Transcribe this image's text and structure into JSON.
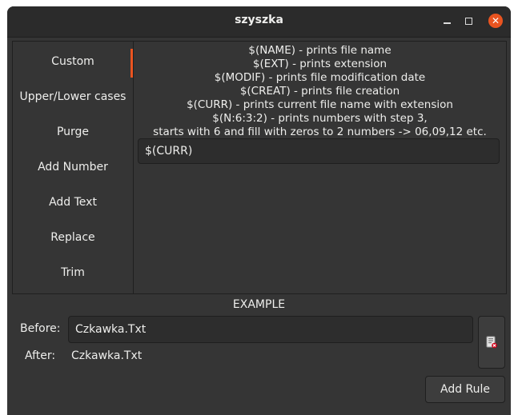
{
  "window": {
    "title": "szyszka"
  },
  "sidebar": {
    "items": [
      {
        "label": "Custom",
        "active": true
      },
      {
        "label": "Upper/Lower cases"
      },
      {
        "label": "Purge"
      },
      {
        "label": "Add Number"
      },
      {
        "label": "Add Text"
      },
      {
        "label": "Replace"
      },
      {
        "label": "Trim"
      }
    ]
  },
  "custom": {
    "description_lines": [
      "$(NAME) - prints file name",
      "$(EXT) - prints extension",
      "$(MODIF) - prints file modification date",
      "$(CREAT) - prints file creation",
      "$(CURR) - prints current file name with extension",
      "$(N:6:3:2) - prints numbers with step 3,",
      "starts with 6 and fill with zeros to 2 numbers -> 06,09,12 etc."
    ],
    "entry_value": "$(CURR)"
  },
  "example": {
    "label": "EXAMPLE",
    "before_label": "Before:",
    "before_value": "Czkawka.Txt",
    "after_label": "After:",
    "after_value": "Czkawka.Txt"
  },
  "buttons": {
    "add_rule": "Add Rule"
  },
  "colors": {
    "accent": "#e95420",
    "window_bg": "#353535",
    "titlebar_bg": "#2b2b2b"
  }
}
